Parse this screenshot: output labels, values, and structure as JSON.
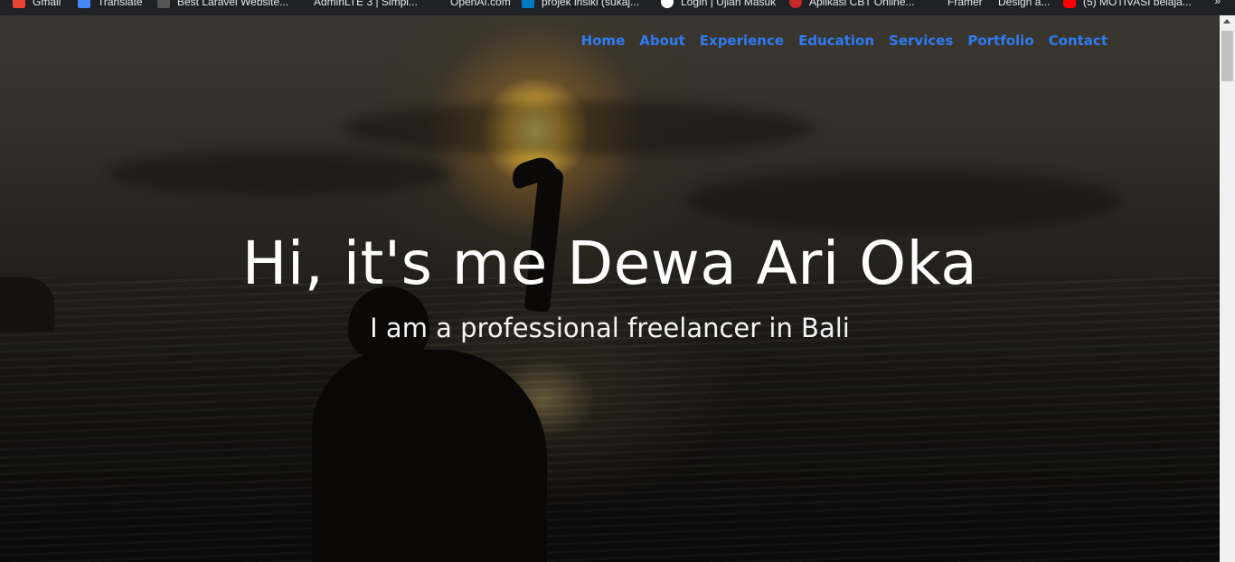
{
  "bookmarks": [
    {
      "label": "Gmail",
      "icon": "gmail-icon",
      "color": "#ea4335"
    },
    {
      "label": "Translate",
      "icon": "translate-icon",
      "color": "#4285f4"
    },
    {
      "label": "Best Laravel Website...",
      "icon": "laravel-icon",
      "color": "#555555"
    },
    {
      "label": "AdminLTE 3 | Simpl...",
      "icon": "adminlte-icon",
      "color": "#202124"
    },
    {
      "label": "OpenAI.com",
      "icon": "openai-icon",
      "color": "#202124"
    },
    {
      "label": "projek insiki (sukaj...",
      "icon": "trello-icon",
      "color": "#0079bf"
    },
    {
      "label": "Login | Ujian Masuk",
      "icon": "globe-icon",
      "color": "#ffffff"
    },
    {
      "label": "Aplikasi CBT Online...",
      "icon": "cbt-icon",
      "color": "#c62828"
    },
    {
      "label": "Framer",
      "icon": "framer-icon",
      "color": "#202124"
    },
    {
      "label": "Design a...",
      "icon": "design-icon",
      "color": "#202124"
    },
    {
      "label": "(5) MOTIVASI belaja...",
      "icon": "youtube-icon",
      "color": "#ff0000"
    }
  ],
  "bookmarks_more": "»",
  "nav": {
    "items": [
      "Home",
      "About",
      "Experience",
      "Education",
      "Services",
      "Portfolio",
      "Contact"
    ],
    "link_color": "#2f7bf0"
  },
  "hero": {
    "headline": "Hi, it's me Dewa Ari Oka",
    "subline": "I am a professional freelancer in Bali"
  }
}
